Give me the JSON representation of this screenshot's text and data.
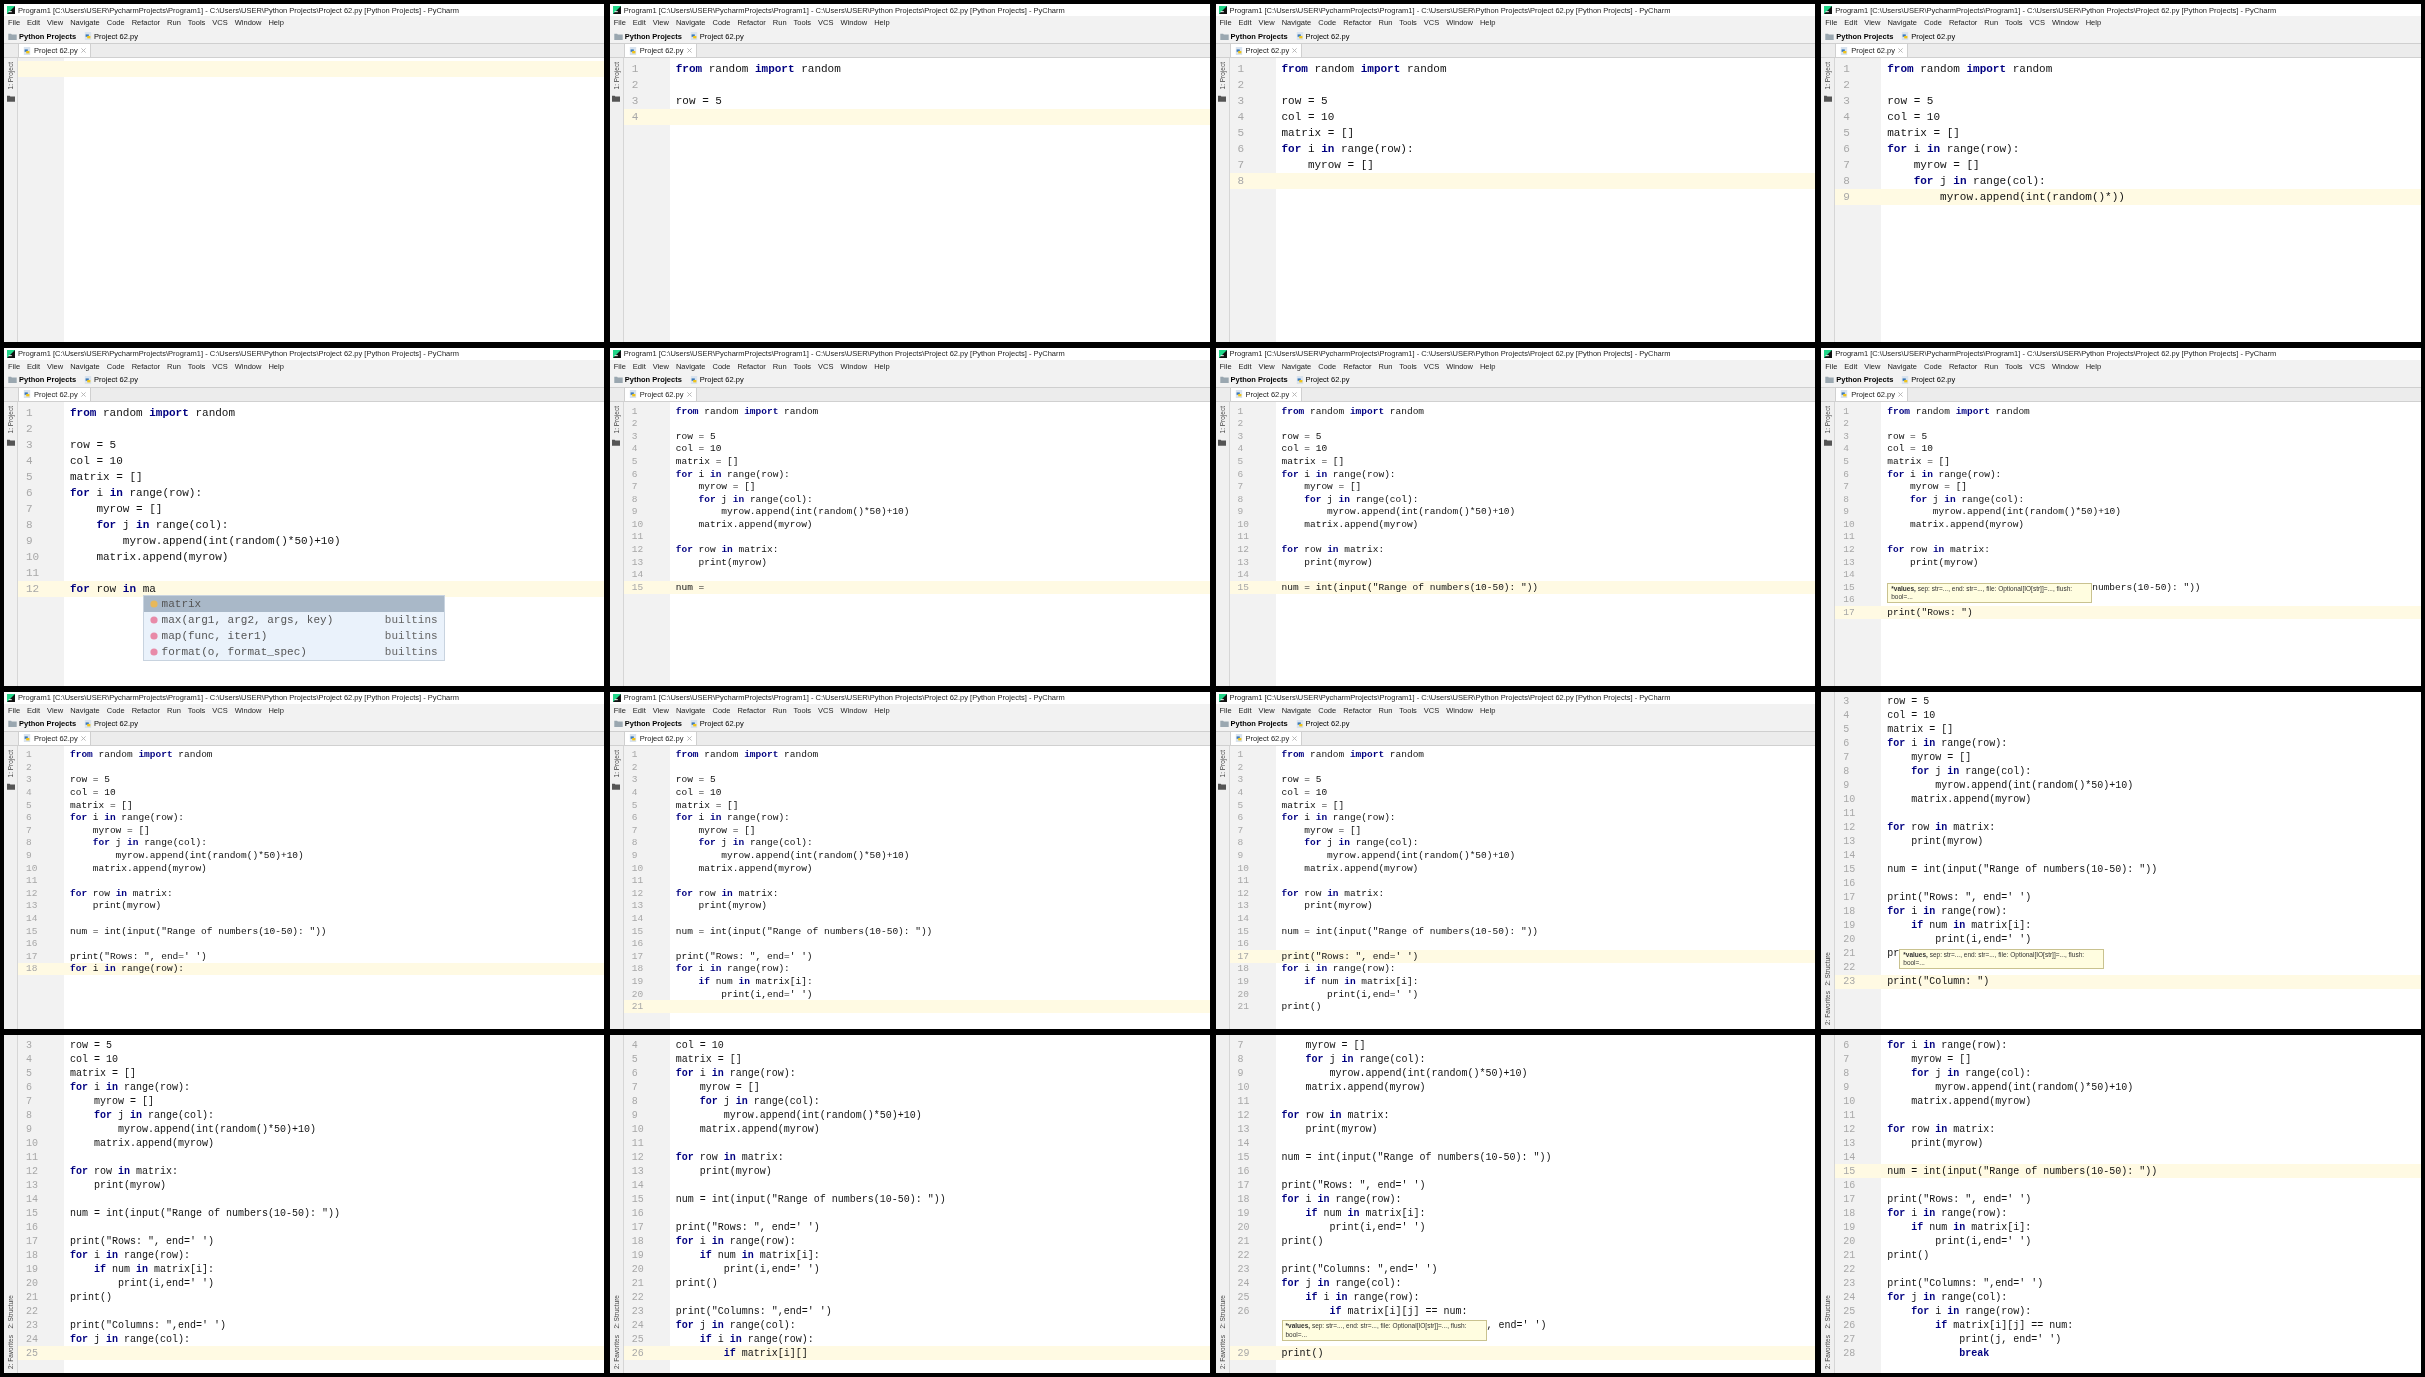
{
  "tiles": [
    {
      "window": {
        "title": "Program1 [C:\\Users\\USER\\PycharmProjects\\Program1] - C:\\Users\\USER\\Python Projects\\Project 62.py [Python Projects] - PyCharm",
        "menu": [
          "File",
          "Edit",
          "View",
          "Navigate",
          "Code",
          "Refactor",
          "Run",
          "Tools",
          "VCS",
          "Window",
          "Help"
        ],
        "breadcrumb": [
          {
            "label": "Python Projects",
            "kind": "folder"
          },
          {
            "label": "Project 62.py",
            "kind": "file"
          }
        ],
        "tab": {
          "label": "Project 62.py",
          "selected": true
        }
      },
      "side_top": [
        "1: Project"
      ],
      "lines": [
        {
          "current": true
        }
      ]
    },
    {
      "window": {
        "title": "Program1 [C:\\Users\\USER\\PycharmProjects\\Program1] - C:\\Users\\USER\\Python Projects\\Project 62.py [Python Projects] - PyCharm",
        "menu": [
          "File",
          "Edit",
          "View",
          "Navigate",
          "Code",
          "Refactor",
          "Run",
          "Tools",
          "VCS",
          "Window",
          "Help"
        ],
        "breadcrumb": [
          {
            "label": "Python Projects",
            "kind": "folder"
          },
          {
            "label": "Project 62.py",
            "kind": "file"
          }
        ],
        "tab": {
          "label": "Project 62.py",
          "selected": true
        }
      },
      "side_top": [
        "1: Project"
      ],
      "lines": [
        {
          "n": "1",
          "code": "**from** random **import** random",
          "current": false
        },
        {
          "n": "2",
          "current": false
        },
        {
          "n": "3",
          "code": "row = 5",
          "current": false
        },
        {
          "n": "4",
          "current": true
        }
      ]
    },
    {
      "window": {
        "title": "Program1 [C:\\Users\\USER\\PycharmProjects\\Program1] - C:\\Users\\USER\\Python Projects\\Project 62.py [Python Projects] - PyCharm",
        "menu": [
          "File",
          "Edit",
          "View",
          "Navigate",
          "Code",
          "Refactor",
          "Run",
          "Tools",
          "VCS",
          "Window",
          "Help"
        ],
        "breadcrumb": [
          {
            "label": "Python Projects",
            "kind": "folder"
          },
          {
            "label": "Project 62.py",
            "kind": "file"
          }
        ],
        "tab": {
          "label": "Project 62.py",
          "selected": true
        }
      },
      "side_top": [
        "1: Project"
      ],
      "lines": [
        {
          "n": "1",
          "code": "**from** random **import** random",
          "current": false
        },
        {
          "n": "2",
          "current": false
        },
        {
          "n": "3",
          "code": "row = 5",
          "current": false
        },
        {
          "n": "4",
          "code": "col = 10",
          "current": false
        },
        {
          "n": "5",
          "code": "matrix = []",
          "current": false
        },
        {
          "n": "6",
          "code": "**for** i **in** range(row):",
          "current": false
        },
        {
          "n": "7",
          "code": "    myrow = []",
          "current": false
        },
        {
          "n": "8",
          "current": true
        }
      ]
    },
    {
      "window": {
        "title": "Program1 [C:\\Users\\USER\\PycharmProjects\\Program1] - C:\\Users\\USER\\Python Projects\\Project 62.py [Python Projects] - PyCharm",
        "menu": [
          "File",
          "Edit",
          "View",
          "Navigate",
          "Code",
          "Refactor",
          "Run",
          "Tools",
          "VCS",
          "Window",
          "Help"
        ],
        "breadcrumb": [
          {
            "label": "Python Projects",
            "kind": "folder"
          },
          {
            "label": "Project 62.py",
            "kind": "file"
          }
        ],
        "tab": {
          "label": "Project 62.py",
          "selected": true
        }
      },
      "side_top": [
        "1: Project"
      ],
      "lines": [
        {
          "n": "1",
          "code": "**from** random **import** random",
          "current": false
        },
        {
          "n": "2",
          "current": false
        },
        {
          "n": "3",
          "code": "row = 5",
          "current": false
        },
        {
          "n": "4",
          "code": "col = 10",
          "current": false
        },
        {
          "n": "5",
          "code": "matrix = []",
          "current": false
        },
        {
          "n": "6",
          "code": "**for** i **in** range(row):",
          "current": false
        },
        {
          "n": "7",
          "code": "    myrow = []",
          "current": false
        },
        {
          "n": "8",
          "code": "    **for** j **in** range(col):",
          "current": false
        },
        {
          "n": "9",
          "code": "        myrow.append(int(random()*))",
          "current": true
        }
      ]
    },
    {
      "window": {
        "title": "Program1 [C:\\Users\\USER\\PycharmProjects\\Program1] - C:\\Users\\USER\\Python Projects\\Project 62.py [Python Projects] - PyCharm",
        "menu": [
          "File",
          "Edit",
          "View",
          "Navigate",
          "Code",
          "Refactor",
          "Run",
          "Tools",
          "VCS",
          "Window",
          "Help"
        ],
        "breadcrumb": [
          {
            "label": "Python Projects",
            "kind": "folder"
          },
          {
            "label": "Project 62.py",
            "kind": "file"
          }
        ],
        "tab": {
          "label": "Project 62.py",
          "selected": true
        }
      },
      "side_top": [
        "1: Project"
      ],
      "lines": [
        {
          "n": "1",
          "code": "**from** random **import** random",
          "current": false
        },
        {
          "n": "2",
          "current": false
        },
        {
          "n": "3",
          "code": "row = 5",
          "current": false
        },
        {
          "n": "4",
          "code": "col = 10",
          "current": false
        },
        {
          "n": "5",
          "code": "matrix = []",
          "current": false
        },
        {
          "n": "6",
          "code": "**for** i **in** range(row):",
          "current": false
        },
        {
          "n": "7",
          "code": "    myrow = []",
          "current": false
        },
        {
          "n": "8",
          "code": "    **for** j **in** range(col):",
          "current": false
        },
        {
          "n": "9",
          "code": "        myrow.append(int(random()*50)+10)",
          "current": false
        },
        {
          "n": "10",
          "code": "    matrix.append(myrow)",
          "current": false
        },
        {
          "n": "11",
          "current": false
        },
        {
          "n": "12",
          "code": "**for** row **in** ma",
          "current": true,
          "popup": [
            {
              "name": "matrix",
              "kind": "variable",
              "selected": true
            },
            {
              "name": "max(arg1, arg2, args, key)",
              "source": "builtins",
              "kind": "function",
              "selected": false
            },
            {
              "name": "map(func, iter1)",
              "source": "builtins",
              "kind": "function",
              "selected": false
            },
            {
              "name": "format(o, format_spec)",
              "source": "builtins",
              "kind": "function",
              "selected": false
            }
          ]
        }
      ]
    },
    {
      "window": {
        "title": "Program1 [C:\\Users\\USER\\PycharmProjects\\Program1] - C:\\Users\\USER\\Python Projects\\Project 62.py [Python Projects] - PyCharm",
        "menu": [
          "File",
          "Edit",
          "View",
          "Navigate",
          "Code",
          "Refactor",
          "Run",
          "Tools",
          "VCS",
          "Window",
          "Help"
        ],
        "breadcrumb": [
          {
            "label": "Python Projects",
            "kind": "folder"
          },
          {
            "label": "Project 62.py",
            "kind": "file"
          }
        ],
        "tab": {
          "label": "Project 62.py",
          "selected": true
        }
      },
      "side_top": [
        "1: Project"
      ],
      "lines": [
        {
          "n": "1",
          "code": "**from** random **import** random",
          "current": false
        },
        {
          "n": "2",
          "current": false
        },
        {
          "n": "3",
          "code": "row = 5",
          "current": false
        },
        {
          "n": "4",
          "code": "col = 10",
          "current": false
        },
        {
          "n": "5",
          "code": "matrix = []",
          "current": false
        },
        {
          "n": "6",
          "code": "**for** i **in** range(row):",
          "current": false
        },
        {
          "n": "7",
          "code": "    myrow = []",
          "current": false
        },
        {
          "n": "8",
          "code": "    **for** j **in** range(col):",
          "current": false
        },
        {
          "n": "9",
          "code": "        myrow.append(int(random()*50)+10)",
          "current": false
        },
        {
          "n": "10",
          "code": "    matrix.append(myrow)",
          "current": false
        },
        {
          "n": "11",
          "current": false
        },
        {
          "n": "12",
          "code": "**for** row **in** matrix:",
          "current": false
        },
        {
          "n": "13",
          "code": "    print(myrow)",
          "current": false
        },
        {
          "n": "14",
          "current": false
        },
        {
          "n": "15",
          "code": "num =",
          "current": true
        }
      ]
    },
    {
      "window": {
        "title": "Program1 [C:\\Users\\USER\\PycharmProjects\\Program1] - C:\\Users\\USER\\Python Projects\\Project 62.py [Python Projects] - PyCharm",
        "menu": [
          "File",
          "Edit",
          "View",
          "Navigate",
          "Code",
          "Refactor",
          "Run",
          "Tools",
          "VCS",
          "Window",
          "Help"
        ],
        "breadcrumb": [
          {
            "label": "Python Projects",
            "kind": "folder"
          },
          {
            "label": "Project 62.py",
            "kind": "file"
          }
        ],
        "tab": {
          "label": "Project 62.py",
          "selected": true
        }
      },
      "side_top": [
        "1: Project"
      ],
      "lines": [
        {
          "n": "1",
          "code": "**from** random **import** random",
          "current": false
        },
        {
          "n": "2",
          "current": false
        },
        {
          "n": "3",
          "code": "row = 5",
          "current": false
        },
        {
          "n": "4",
          "code": "col = 10",
          "current": false
        },
        {
          "n": "5",
          "code": "matrix = []",
          "current": false
        },
        {
          "n": "6",
          "code": "**for** i **in** range(row):",
          "current": false
        },
        {
          "n": "7",
          "code": "    myrow = []",
          "current": false
        },
        {
          "n": "8",
          "code": "    **for** j **in** range(col):",
          "current": false
        },
        {
          "n": "9",
          "code": "        myrow.append(int(random()*50)+10)",
          "current": false
        },
        {
          "n": "10",
          "code": "    matrix.append(myrow)",
          "current": false
        },
        {
          "n": "11",
          "current": false
        },
        {
          "n": "12",
          "code": "**for** row **in** matrix:",
          "current": false
        },
        {
          "n": "13",
          "code": "    print(myrow)",
          "current": false
        },
        {
          "n": "14",
          "current": false
        },
        {
          "n": "15",
          "code": "num = int(input(\"Range of numbers(10-50): \"))",
          "current": true
        }
      ]
    },
    {
      "window": {
        "title": "Program1 [C:\\Users\\USER\\PycharmProjects\\Program1] - C:\\Users\\USER\\Python Projects\\Project 62.py [Python Projects] - PyCharm",
        "menu": [
          "File",
          "Edit",
          "View",
          "Navigate",
          "Code",
          "Refactor",
          "Run",
          "Tools",
          "VCS",
          "Window",
          "Help"
        ],
        "breadcrumb": [
          {
            "label": "Python Projects",
            "kind": "folder"
          },
          {
            "label": "Project 62.py",
            "kind": "file"
          }
        ],
        "tab": {
          "label": "Project 62.py",
          "selected": true
        }
      },
      "side_top": [
        "1: Project"
      ],
      "lines": [
        {
          "n": "1",
          "code": "**from** random **import** random",
          "current": false
        },
        {
          "n": "2",
          "current": false
        },
        {
          "n": "3",
          "code": "row = 5",
          "current": false
        },
        {
          "n": "4",
          "code": "col = 10",
          "current": false
        },
        {
          "n": "5",
          "code": "matrix = []",
          "current": false
        },
        {
          "n": "6",
          "code": "**for** i **in** range(row):",
          "current": false
        },
        {
          "n": "7",
          "code": "    myrow = []",
          "current": false
        },
        {
          "n": "8",
          "code": "    **for** j **in** range(col):",
          "current": false
        },
        {
          "n": "9",
          "code": "        myrow.append(int(random()*50)+10)",
          "current": false
        },
        {
          "n": "10",
          "code": "    matrix.append(myrow)",
          "current": false
        },
        {
          "n": "11",
          "current": false
        },
        {
          "n": "12",
          "code": "**for** row **in** matrix:",
          "current": false
        },
        {
          "n": "13",
          "code": "    print(myrow)",
          "current": false
        },
        {
          "n": "14",
          "current": false
        },
        {
          "n": "15",
          "tooltip": {
            "bold": "*values,",
            "text": "sep: str=..., end: str=..., file: Optional[IO[str]]=..., flush: bool=..."
          },
          "code_after": "numbers(10-50): \"))",
          "current": false
        },
        {
          "n": "16",
          "current": false
        },
        {
          "n": "17",
          "code": "print(\"Rows: \")",
          "current": true
        }
      ]
    },
    {
      "window": {
        "title": "Program1 [C:\\Users\\USER\\PycharmProjects\\Program1] - C:\\Users\\USER\\Python Projects\\Project 62.py [Python Projects] - PyCharm",
        "menu": [
          "File",
          "Edit",
          "View",
          "Navigate",
          "Code",
          "Refactor",
          "Run",
          "Tools",
          "VCS",
          "Window",
          "Help"
        ],
        "breadcrumb": [
          {
            "label": "Python Projects",
            "kind": "folder"
          },
          {
            "label": "Project 62.py",
            "kind": "file"
          }
        ],
        "tab": {
          "label": "Project 62.py",
          "selected": true
        }
      },
      "side_top": [
        "1: Project"
      ],
      "lines": [
        {
          "n": "1",
          "code": "**from** random **import** random",
          "current": false
        },
        {
          "n": "2",
          "current": false
        },
        {
          "n": "3",
          "code": "row = 5",
          "current": false
        },
        {
          "n": "4",
          "code": "col = 10",
          "current": false
        },
        {
          "n": "5",
          "code": "matrix = []",
          "current": false
        },
        {
          "n": "6",
          "code": "**for** i **in** range(row):",
          "current": false
        },
        {
          "n": "7",
          "code": "    myrow = []",
          "current": false
        },
        {
          "n": "8",
          "code": "    **for** j **in** range(col):",
          "current": false
        },
        {
          "n": "9",
          "code": "        myrow.append(int(random()*50)+10)",
          "current": false
        },
        {
          "n": "10",
          "code": "    matrix.append(myrow)",
          "current": false
        },
        {
          "n": "11",
          "current": false
        },
        {
          "n": "12",
          "code": "**for** row **in** matrix:",
          "current": false
        },
        {
          "n": "13",
          "code": "    print(myrow)",
          "current": false
        },
        {
          "n": "14",
          "current": false
        },
        {
          "n": "15",
          "code": "num = int(input(\"Range of numbers(10-50): \"))",
          "current": false
        },
        {
          "n": "16",
          "current": false
        },
        {
          "n": "17",
          "code": "print(\"Rows: \", end=' ')",
          "current": false
        },
        {
          "n": "18",
          "code": "**for** i **in** range(row):",
          "current": true
        }
      ]
    },
    {
      "window": {
        "title": "Program1 [C:\\Users\\USER\\PycharmProjects\\Program1] - C:\\Users\\USER\\Python Projects\\Project 62.py [Python Projects] - PyCharm",
        "menu": [
          "File",
          "Edit",
          "View",
          "Navigate",
          "Code",
          "Refactor",
          "Run",
          "Tools",
          "VCS",
          "Window",
          "Help"
        ],
        "breadcrumb": [
          {
            "label": "Python Projects",
            "kind": "folder"
          },
          {
            "label": "Project 62.py",
            "kind": "file"
          }
        ],
        "tab": {
          "label": "Project 62.py",
          "selected": true
        }
      },
      "side_top": [
        "1: Project"
      ],
      "lines": [
        {
          "n": "1",
          "code": "**from** random **import** random",
          "current": false
        },
        {
          "n": "2",
          "current": false
        },
        {
          "n": "3",
          "code": "row = 5",
          "current": false
        },
        {
          "n": "4",
          "code": "col = 10",
          "current": false
        },
        {
          "n": "5",
          "code": "matrix = []",
          "current": false
        },
        {
          "n": "6",
          "code": "**for** i **in** range(row):",
          "current": false
        },
        {
          "n": "7",
          "code": "    myrow = []",
          "current": false
        },
        {
          "n": "8",
          "code": "    **for** j **in** range(col):",
          "current": false
        },
        {
          "n": "9",
          "code": "        myrow.append(int(random()*50)+10)",
          "current": false
        },
        {
          "n": "10",
          "code": "    matrix.append(myrow)",
          "current": false
        },
        {
          "n": "11",
          "current": false
        },
        {
          "n": "12",
          "code": "**for** row **in** matrix:",
          "current": false
        },
        {
          "n": "13",
          "code": "    print(myrow)",
          "current": false
        },
        {
          "n": "14",
          "current": false
        },
        {
          "n": "15",
          "code": "num = int(input(\"Range of numbers(10-50): \"))",
          "current": false
        },
        {
          "n": "16",
          "current": false
        },
        {
          "n": "17",
          "code": "print(\"Rows: \", end=' ')",
          "current": false
        },
        {
          "n": "18",
          "code": "**for** i **in** range(row):",
          "current": false
        },
        {
          "n": "19",
          "code": "    **if** num **in** matrix[i]:",
          "current": false
        },
        {
          "n": "20",
          "code": "        print(i,end=' ')",
          "current": false
        },
        {
          "n": "21",
          "current": true
        }
      ]
    },
    {
      "window": {
        "title": "Program1 [C:\\Users\\USER\\PycharmProjects\\Program1] - C:\\Users\\USER\\Python Projects\\Project 62.py [Python Projects] - PyCharm",
        "menu": [
          "File",
          "Edit",
          "View",
          "Navigate",
          "Code",
          "Refactor",
          "Run",
          "Tools",
          "VCS",
          "Window",
          "Help"
        ],
        "breadcrumb": [
          {
            "label": "Python Projects",
            "kind": "folder"
          },
          {
            "label": "Project 62.py",
            "kind": "file"
          }
        ],
        "tab": {
          "label": "Project 62.py",
          "selected": true
        }
      },
      "side_top": [
        "1: Project"
      ],
      "lines": [
        {
          "n": "1",
          "code": "**from** random **import** random",
          "current": false
        },
        {
          "n": "2",
          "current": false
        },
        {
          "n": "3",
          "code": "row = 5",
          "current": false
        },
        {
          "n": "4",
          "code": "col = 10",
          "current": false
        },
        {
          "n": "5",
          "code": "matrix = []",
          "current": false
        },
        {
          "n": "6",
          "code": "**for** i **in** range(row):",
          "current": false
        },
        {
          "n": "7",
          "code": "    myrow = []",
          "current": false
        },
        {
          "n": "8",
          "code": "    **for** j **in** range(col):",
          "current": false
        },
        {
          "n": "9",
          "code": "        myrow.append(int(random()*50)+10)",
          "current": false
        },
        {
          "n": "10",
          "code": "    matrix.append(myrow)",
          "current": false
        },
        {
          "n": "11",
          "current": false
        },
        {
          "n": "12",
          "code": "**for** row **in** matrix:",
          "current": false
        },
        {
          "n": "13",
          "code": "    print(myrow)",
          "current": false
        },
        {
          "n": "14",
          "current": false
        },
        {
          "n": "15",
          "code": "num = int(input(\"Range of numbers(10-50): \"))",
          "current": false
        },
        {
          "n": "16",
          "current": false
        },
        {
          "n": "17",
          "code": "print(\"Rows: \", end=' ')",
          "current": true
        },
        {
          "n": "18",
          "code": "**for** i **in** range(row):",
          "current": false
        },
        {
          "n": "19",
          "code": "    **if** num **in** matrix[i]:",
          "current": false
        },
        {
          "n": "20",
          "code": "        print(i,end=' ')",
          "current": false
        },
        {
          "n": "21",
          "code": "print()",
          "current": false
        }
      ]
    },
    {
      "side_bottom": [
        "2: Structure",
        "2: Favorites"
      ],
      "lines": [
        {
          "n": "3",
          "code": "row = 5",
          "current": false
        },
        {
          "n": "4",
          "code": "col = 10",
          "current": false
        },
        {
          "n": "5",
          "code": "matrix = []",
          "current": false
        },
        {
          "n": "6",
          "code": "**for** i **in** range(row):",
          "current": false
        },
        {
          "n": "7",
          "code": "    myrow = []",
          "current": false
        },
        {
          "n": "8",
          "code": "    **for** j **in** range(col):",
          "current": false
        },
        {
          "n": "9",
          "code": "        myrow.append(int(random()*50)+10)",
          "current": false
        },
        {
          "n": "10",
          "code": "    matrix.append(myrow)",
          "current": false
        },
        {
          "n": "11",
          "current": false
        },
        {
          "n": "12",
          "code": "**for** row **in** matrix:",
          "current": false
        },
        {
          "n": "13",
          "code": "    print(myrow)",
          "current": false
        },
        {
          "n": "14",
          "current": false
        },
        {
          "n": "15",
          "code": "num = int(input(\"Range of numbers(10-50): \"))",
          "current": false
        },
        {
          "n": "16",
          "current": false
        },
        {
          "n": "17",
          "code": "print(\"Rows: \", end=' ')",
          "current": false
        },
        {
          "n": "18",
          "code": "**for** i **in** range(row):",
          "current": false
        },
        {
          "n": "19",
          "code": "    **if** num **in** matrix[i]:",
          "current": false
        },
        {
          "n": "20",
          "code": "        print(i,end=' ')",
          "current": false
        },
        {
          "n": "21",
          "code": "pr",
          "tooltip": {
            "bold": "*values,",
            "text": "sep: str=..., end: str=..., file: Optional[IO[str]]=..., flush: bool=..."
          },
          "current": false
        },
        {
          "n": "22",
          "current": false
        },
        {
          "n": "23",
          "code": "print(\"Column: \")",
          "current": true
        }
      ]
    },
    {
      "side_bottom": [
        "2: Structure",
        "2: Favorites"
      ],
      "lines": [
        {
          "n": "3",
          "code": "row = 5",
          "current": false
        },
        {
          "n": "4",
          "code": "col = 10",
          "current": false
        },
        {
          "n": "5",
          "code": "matrix = []",
          "current": false
        },
        {
          "n": "6",
          "code": "**for** i **in** range(row):",
          "current": false
        },
        {
          "n": "7",
          "code": "    myrow = []",
          "current": false
        },
        {
          "n": "8",
          "code": "    **for** j **in** range(col):",
          "current": false
        },
        {
          "n": "9",
          "code": "        myrow.append(int(random()*50)+10)",
          "current": false
        },
        {
          "n": "10",
          "code": "    matrix.append(myrow)",
          "current": false
        },
        {
          "n": "11",
          "current": false
        },
        {
          "n": "12",
          "code": "**for** row **in** matrix:",
          "current": false
        },
        {
          "n": "13",
          "code": "    print(myrow)",
          "current": false
        },
        {
          "n": "14",
          "current": false
        },
        {
          "n": "15",
          "code": "num = int(input(\"Range of numbers(10-50): \"))",
          "current": false
        },
        {
          "n": "16",
          "current": false
        },
        {
          "n": "17",
          "code": "print(\"Rows: \", end=' ')",
          "current": false
        },
        {
          "n": "18",
          "code": "**for** i **in** range(row):",
          "current": false
        },
        {
          "n": "19",
          "code": "    **if** num **in** matrix[i]:",
          "current": false
        },
        {
          "n": "20",
          "code": "        print(i,end=' ')",
          "current": false
        },
        {
          "n": "21",
          "code": "print()",
          "current": false
        },
        {
          "n": "22",
          "current": false
        },
        {
          "n": "23",
          "code": "print(\"Columns: \",end=' ')",
          "current": false
        },
        {
          "n": "24",
          "code": "**for** j **in** range(col):",
          "current": false
        },
        {
          "n": "25",
          "current": true
        }
      ]
    },
    {
      "side_bottom": [
        "2: Structure",
        "2: Favorites"
      ],
      "lines": [
        {
          "n": "4",
          "code": "col = 10",
          "current": false
        },
        {
          "n": "5",
          "code": "matrix = []",
          "current": false
        },
        {
          "n": "6",
          "code": "**for** i **in** range(row):",
          "current": false
        },
        {
          "n": "7",
          "code": "    myrow = []",
          "current": false
        },
        {
          "n": "8",
          "code": "    **for** j **in** range(col):",
          "current": false
        },
        {
          "n": "9",
          "code": "        myrow.append(int(random()*50)+10)",
          "current": false
        },
        {
          "n": "10",
          "code": "    matrix.append(myrow)",
          "current": false
        },
        {
          "n": "11",
          "current": false
        },
        {
          "n": "12",
          "code": "**for** row **in** matrix:",
          "current": false
        },
        {
          "n": "13",
          "code": "    print(myrow)",
          "current": false
        },
        {
          "n": "14",
          "current": false
        },
        {
          "n": "15",
          "code": "num = int(input(\"Range of numbers(10-50): \"))",
          "current": false
        },
        {
          "n": "16",
          "current": false
        },
        {
          "n": "17",
          "code": "print(\"Rows: \", end=' ')",
          "current": false
        },
        {
          "n": "18",
          "code": "**for** i **in** range(row):",
          "current": false
        },
        {
          "n": "19",
          "code": "    **if** num **in** matrix[i]:",
          "current": false
        },
        {
          "n": "20",
          "code": "        print(i,end=' ')",
          "current": false
        },
        {
          "n": "21",
          "code": "print()",
          "current": false
        },
        {
          "n": "22",
          "current": false
        },
        {
          "n": "23",
          "code": "print(\"Columns: \",end=' ')",
          "current": false
        },
        {
          "n": "24",
          "code": "**for** j **in** range(col):",
          "current": false
        },
        {
          "n": "25",
          "code": "    **if** i **in** range(row):",
          "current": false
        },
        {
          "n": "26",
          "code": "        **if** matrix[i][]",
          "current": true
        }
      ]
    },
    {
      "side_bottom": [
        "2: Structure",
        "2: Favorites"
      ],
      "lines": [
        {
          "n": "7",
          "code": "    myrow = []",
          "current": false
        },
        {
          "n": "8",
          "code": "    **for** j **in** range(col):",
          "current": false
        },
        {
          "n": "9",
          "code": "        myrow.append(int(random()*50)+10)",
          "current": false
        },
        {
          "n": "10",
          "code": "    matrix.append(myrow)",
          "current": false
        },
        {
          "n": "11",
          "current": false
        },
        {
          "n": "12",
          "code": "**for** row **in** matrix:",
          "current": false
        },
        {
          "n": "13",
          "code": "    print(myrow)",
          "current": false
        },
        {
          "n": "14",
          "current": false
        },
        {
          "n": "15",
          "code": "num = int(input(\"Range of numbers(10-50): \"))",
          "current": false
        },
        {
          "n": "16",
          "current": false
        },
        {
          "n": "17",
          "code": "print(\"Rows: \", end=' ')",
          "current": false
        },
        {
          "n": "18",
          "code": "**for** i **in** range(row):",
          "current": false
        },
        {
          "n": "19",
          "code": "    **if** num **in** matrix[i]:",
          "current": false
        },
        {
          "n": "20",
          "code": "        print(i,end=' ')",
          "current": false
        },
        {
          "n": "21",
          "code": "print()",
          "current": false
        },
        {
          "n": "22",
          "current": false
        },
        {
          "n": "23",
          "code": "print(\"Columns: \",end=' ')",
          "current": false
        },
        {
          "n": "24",
          "code": "**for** j **in** range(col):",
          "current": false
        },
        {
          "n": "25",
          "code": "    **if** i **in** range(row):",
          "current": false
        },
        {
          "n": "26",
          "code": "        **if** matrix[i][j] == num:",
          "current": false
        },
        {
          "tooltip": {
            "bold": "*values,",
            "text": "sep: str=..., end: str=..., file: Optional[IO[str]]=..., flush: bool=..."
          },
          "code_after": ", end=' ')",
          "current": false
        },
        {
          "current": false
        },
        {
          "n": "29",
          "code": "print()",
          "current": true
        }
      ]
    },
    {
      "side_bottom": [
        "2: Structure",
        "2: Favorites"
      ],
      "lines": [
        {
          "n": "6",
          "code": "**for** i **in** range(row):",
          "current": false
        },
        {
          "n": "7",
          "code": "    myrow = []",
          "current": false
        },
        {
          "n": "8",
          "code": "    **for** j **in** range(col):",
          "current": false
        },
        {
          "n": "9",
          "code": "        myrow.append(int(random()*50)+10)",
          "current": false
        },
        {
          "n": "10",
          "code": "    matrix.append(myrow)",
          "current": false
        },
        {
          "n": "11",
          "current": false
        },
        {
          "n": "12",
          "code": "**for** row **in** matrix:",
          "current": false
        },
        {
          "n": "13",
          "code": "    print(myrow)",
          "current": false
        },
        {
          "n": "14",
          "current": false
        },
        {
          "n": "15",
          "code": "num = int(input(\"Range of numbers(10-50): \"))",
          "current": true
        },
        {
          "n": "16",
          "current": false
        },
        {
          "n": "17",
          "code": "print(\"Rows: \", end=' ')",
          "current": false
        },
        {
          "n": "18",
          "code": "**for** i **in** range(row):",
          "current": false
        },
        {
          "n": "19",
          "code": "    **if** num **in** matrix[i]:",
          "current": false
        },
        {
          "n": "20",
          "code": "        print(i,end=' ')",
          "current": false
        },
        {
          "n": "21",
          "code": "print()",
          "current": false
        },
        {
          "n": "22",
          "current": false
        },
        {
          "n": "23",
          "code": "print(\"Columns: \",end=' ')",
          "current": false
        },
        {
          "n": "24",
          "code": "**for** j **in** range(col):",
          "current": false
        },
        {
          "n": "25",
          "code": "    **for** i **in** range(row):",
          "current": false
        },
        {
          "n": "26",
          "code": "        **if** matrix[i][j] == num:",
          "current": false
        },
        {
          "n": "27",
          "code": "            print(j, end=' ')",
          "current": false
        },
        {
          "n": "28",
          "code": "            **break**",
          "current": false
        }
      ]
    }
  ]
}
